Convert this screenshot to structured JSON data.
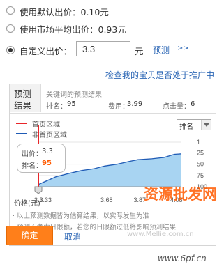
{
  "options": {
    "default_label": "使用默认出价：0.10元",
    "market_label": "使用市场平均出价：0.93元",
    "custom_label": "自定义出价：",
    "custom_value": "3.3",
    "unit": "元",
    "predict_link": "预测",
    "predict_arrows": ">>"
  },
  "check_link": "检查我的宝贝是否处于推广中",
  "prediction": {
    "tag_line1": "预测",
    "tag_line2": "结果",
    "title": "关键词的预测结果",
    "rank_label": "排名：",
    "rank_value": "95",
    "cost_label": "费用：",
    "cost_value": "3.99",
    "clicks_label": "点击量：",
    "clicks_value": "6"
  },
  "legend": {
    "first_page": "首页区域",
    "non_first_page": "非首页区域"
  },
  "sort_select": {
    "value": "排名"
  },
  "tooltip": {
    "bid_label": "出价：",
    "bid_value": "3.3",
    "rank_label": "排名：",
    "rank_value": "95"
  },
  "chart_data": {
    "type": "area",
    "xlabel": "价格(元)",
    "x_ticks": [
      "3.3",
      "3.33",
      "3.68",
      "3.87",
      "4.08"
    ],
    "y_ticks": [
      "1",
      "25",
      "50",
      "75",
      "100"
    ],
    "ylim": [
      1,
      100
    ],
    "y_inverted": true,
    "series": [
      {
        "name": "首页区域",
        "color": "#e8262a"
      },
      {
        "name": "非首页区域",
        "color": "#1f5bb5"
      }
    ],
    "x": [
      3.3,
      3.33,
      3.4,
      3.48,
      3.55,
      3.62,
      3.68,
      3.75,
      3.82,
      3.87,
      3.95,
      4.02,
      4.08,
      4.12
    ],
    "y": [
      95,
      90,
      78,
      70,
      64,
      60,
      54,
      50,
      44,
      40,
      38,
      35,
      28,
      27
    ],
    "marker": {
      "x": 3.3,
      "color": "#e8262a"
    }
  },
  "notes": {
    "line1": "· 以上预测数据皆为估算结果，以实际发生为准",
    "line2": "· 预测不考虑日限额，若您的日限额过低将影响预测结果"
  },
  "buttons": {
    "ok": "确定",
    "cancel": "取消"
  },
  "watermark": {
    "text": "资源批发网",
    "site": "www.Mellie.com.cn",
    "url": "www.6pf.cn"
  },
  "colors": {
    "link": "#2b66b5",
    "accent": "#ff7f1a",
    "area": "#a8d4f2"
  }
}
